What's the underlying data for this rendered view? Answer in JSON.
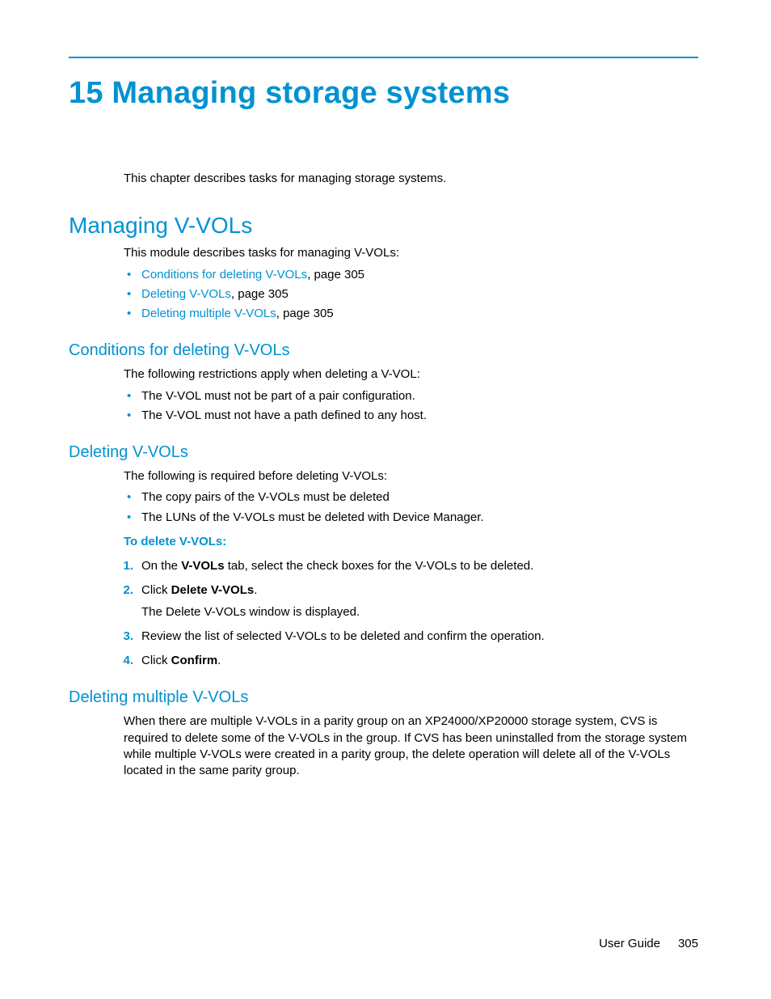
{
  "chapter_title": "15 Managing storage systems",
  "intro": "This chapter describes tasks for managing storage systems.",
  "section1": {
    "title": "Managing V-VOLs",
    "body": "This module describes tasks for managing V-VOLs:",
    "links": [
      {
        "text": "Conditions for deleting V-VOLs",
        "suffix": ", page 305"
      },
      {
        "text": "Deleting V-VOLs",
        "suffix": ", page 305"
      },
      {
        "text": "Deleting multiple V-VOLs",
        "suffix": ", page 305"
      }
    ]
  },
  "subsec1": {
    "title": "Conditions for deleting V-VOLs",
    "body": "The following restrictions apply when deleting a V-VOL:",
    "bullets": [
      "The V-VOL must not be part of a pair configuration.",
      "The V-VOL must not have a path defined to any host."
    ]
  },
  "subsec2": {
    "title": "Deleting V-VOLs",
    "body": "The following is required before deleting V-VOLs:",
    "bullets": [
      "The copy pairs of the V-VOLs must be deleted",
      "The LUNs of the V-VOLs must be deleted with Device Manager."
    ],
    "proc_title": "To delete V-VOLs:",
    "steps": {
      "s1a": "On the ",
      "s1b": "V-VOLs",
      "s1c": " tab, select the check boxes for the V-VOLs to be deleted.",
      "s2a": "Click ",
      "s2b": "Delete V-VOLs",
      "s2c": ".",
      "s2sub": "The Delete V-VOLs window is displayed.",
      "s3": "Review the list of selected V-VOLs to be deleted and confirm the operation.",
      "s4a": "Click ",
      "s4b": "Confirm",
      "s4c": "."
    }
  },
  "subsec3": {
    "title": "Deleting multiple V-VOLs",
    "body": "When there are multiple V-VOLs in a parity group on an XP24000/XP20000 storage system, CVS is required to delete some of the V-VOLs in the group. If CVS has been uninstalled from the storage system while multiple V-VOLs were created in a parity group, the delete operation will delete all of the V-VOLs located in the same parity group."
  },
  "footer": {
    "label": "User Guide",
    "page": "305"
  }
}
